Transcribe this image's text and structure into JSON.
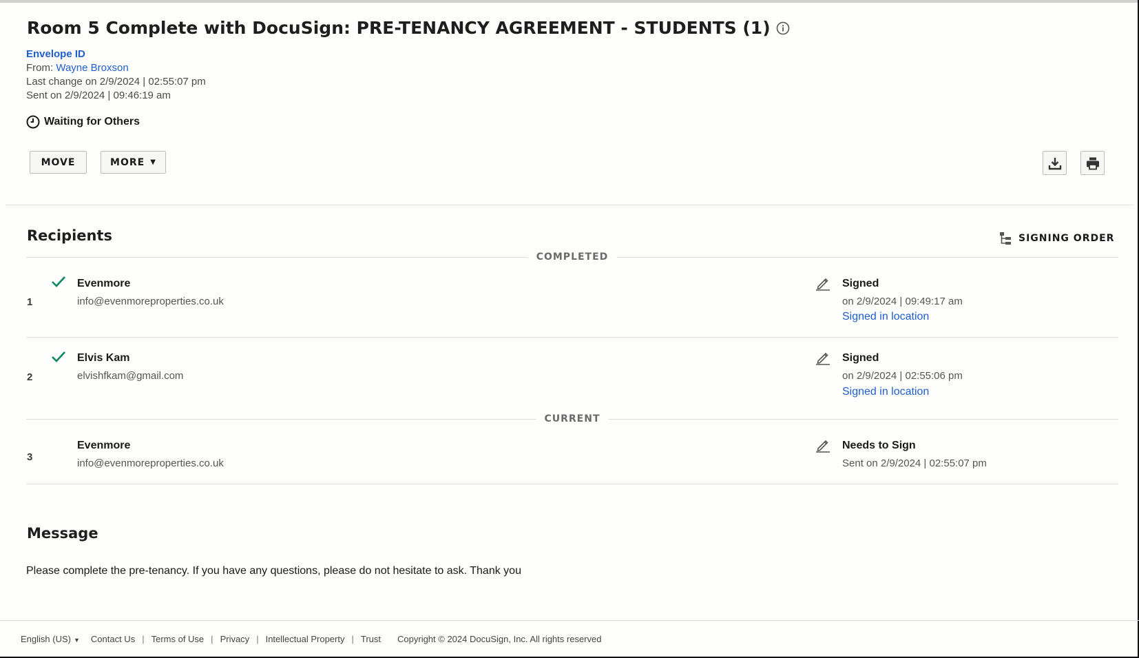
{
  "envelope": {
    "title": "Room 5 Complete with DocuSign: PRE-TENANCY AGREEMENT - STUDENTS (1)",
    "envelope_id_label": "Envelope ID",
    "from_label": "From:",
    "from_name": "Wayne Broxson",
    "last_change": "Last change on 2/9/2024 | 02:55:07 pm",
    "sent": "Sent on 2/9/2024 | 09:46:19 am",
    "status": "Waiting for Others"
  },
  "actions": {
    "move": "MOVE",
    "more": "MORE",
    "download_icon": "download-icon",
    "print_icon": "printer-icon"
  },
  "recipients": {
    "heading": "Recipients",
    "signing_order": "SIGNING ORDER",
    "groups": {
      "completed": "COMPLETED",
      "current": "CURRENT"
    },
    "list": [
      {
        "order": "1",
        "name": "Evenmore",
        "email": "info@evenmoreproperties.co.uk",
        "status": "Signed",
        "date": "on 2/9/2024 | 09:49:17 am",
        "link": "Signed in location",
        "completed": true
      },
      {
        "order": "2",
        "name": "Elvis Kam",
        "email": "elvishfkam@gmail.com",
        "status": "Signed",
        "date": "on 2/9/2024 | 02:55:06 pm",
        "link": "Signed in location",
        "completed": true
      },
      {
        "order": "3",
        "name": "Evenmore",
        "email": "info@evenmoreproperties.co.uk",
        "status": "Needs to Sign",
        "date": "Sent on 2/9/2024 | 02:55:07 pm",
        "completed": false
      }
    ]
  },
  "message": {
    "heading": "Message",
    "text": "Please complete the pre-tenancy. If you have any questions, please do not hesitate to ask. Thank you"
  },
  "footer": {
    "language": "English (US)",
    "links": [
      "Contact Us",
      "Terms of Use",
      "Privacy",
      "Intellectual Property",
      "Trust"
    ],
    "copyright": "Copyright © 2024 DocuSign, Inc. All rights reserved"
  },
  "colors": {
    "link": "#1f5ecf",
    "check": "#0a8a5c",
    "background": "#fdfdfb"
  }
}
